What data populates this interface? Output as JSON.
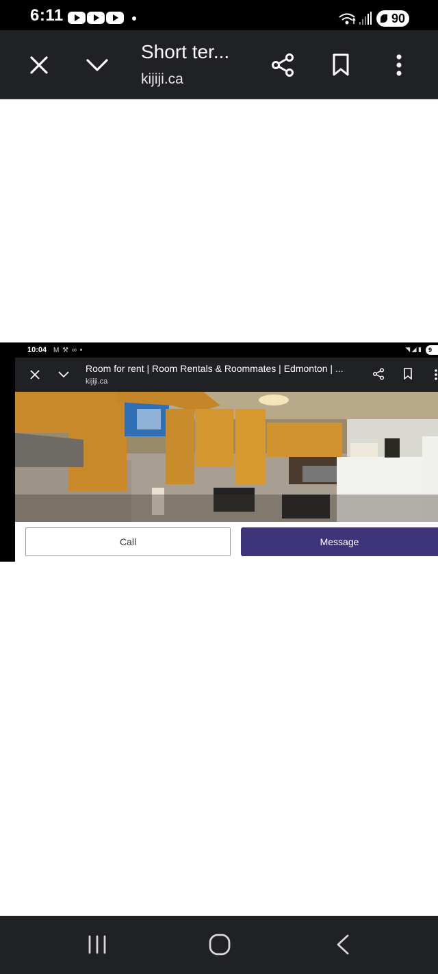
{
  "status_bar": {
    "time": "6:11",
    "battery": "90",
    "icons": [
      "youtube-icon",
      "youtube-icon",
      "youtube-icon",
      "notification-dot",
      "wifi-icon",
      "signal-icon",
      "battery-icon"
    ]
  },
  "custom_tab": {
    "title": "Short ter...",
    "url": "kijiji.ca",
    "icons": [
      "close-icon",
      "chevron-down-icon",
      "share-icon",
      "bookmark-icon",
      "more-vert-icon"
    ]
  },
  "embedded_screenshot": {
    "status_time": "10:04",
    "status_icons": "M ⚒ ∞ •",
    "battery": "9",
    "tab_title": "Room for rent | Room Rentals & Roommates | Edmonton | ...",
    "tab_url": "kijiji.ca",
    "call_label": "Call",
    "message_label": "Message"
  },
  "nav_bar": {
    "icons": [
      "recent-apps-icon",
      "home-icon",
      "back-icon"
    ]
  },
  "colors": {
    "toolbar": "#202124",
    "message_button": "#3e3479",
    "status_bar": "#000000"
  }
}
